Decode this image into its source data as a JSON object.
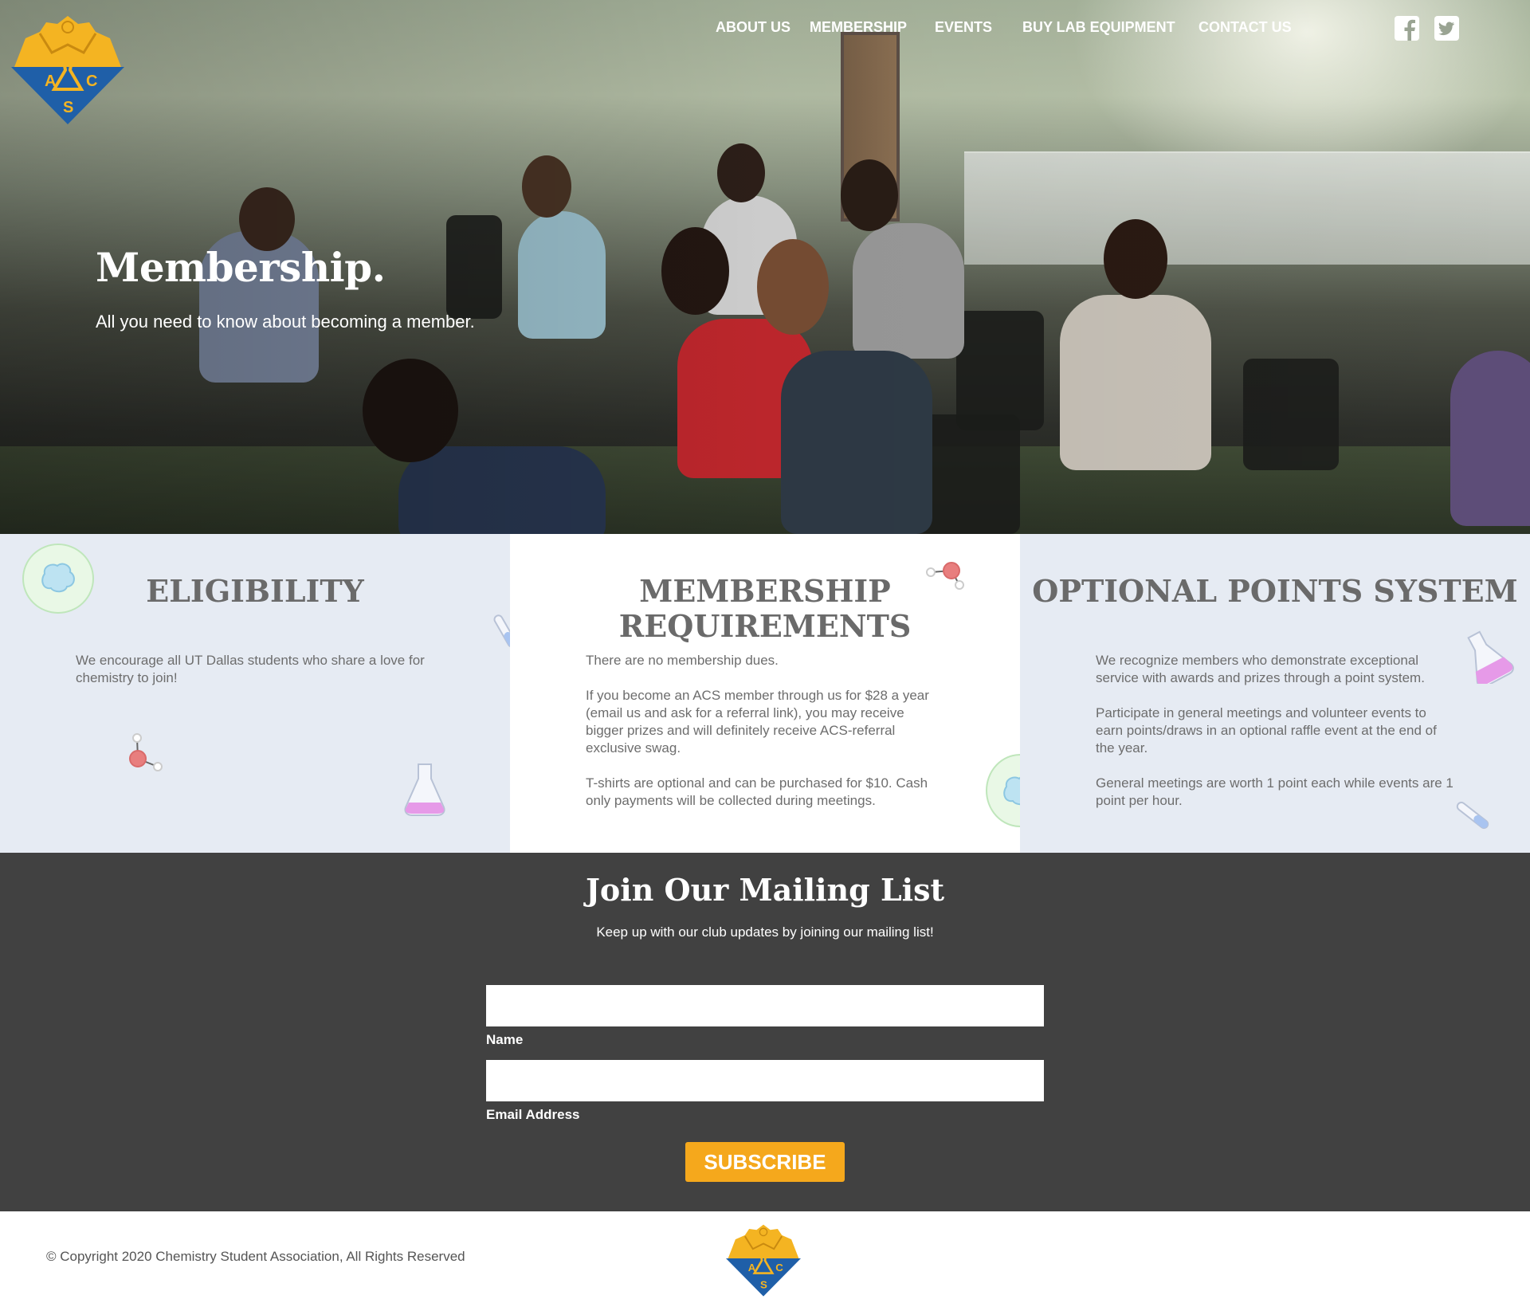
{
  "nav": {
    "items": [
      {
        "label": "ABOUT US"
      },
      {
        "label": "MEMBERSHIP"
      },
      {
        "label": "EVENTS"
      },
      {
        "label": "BUY LAB EQUIPMENT"
      },
      {
        "label": "CONTACT US"
      }
    ],
    "social": [
      {
        "icon": "facebook-icon"
      },
      {
        "icon": "twitter-icon"
      }
    ]
  },
  "logo": {
    "letters": [
      "A",
      "C",
      "S"
    ]
  },
  "hero": {
    "title": "Membership.",
    "subtitle": "All you need to know about becoming a member."
  },
  "columns": {
    "eligibility": {
      "title": "ELIGIBILITY",
      "paragraphs": [
        "We encourage all UT Dallas students who share a love for chemistry to join!"
      ]
    },
    "requirements": {
      "title_line1": "MEMBERSHIP",
      "title_line2": "REQUIREMENTS",
      "paragraphs": [
        "There are no membership dues.",
        "If you become an ACS member through us for $28 a year (email us and ask for a referral link), you may receive bigger prizes and will definitely receive ACS-referral exclusive swag.",
        "T-shirts are optional and can be purchased for $10. Cash only payments will be collected during meetings."
      ]
    },
    "points": {
      "title": "OPTIONAL POINTS SYSTEM",
      "paragraphs": [
        "We recognize members who demonstrate exceptional service with awards and prizes through a point system.",
        "Participate in general meetings and volunteer events to earn points/draws in an optional raffle event at the end of the year.",
        "General meetings are worth 1 point each while events are 1 point per hour."
      ]
    }
  },
  "mailing": {
    "title": "Join Our Mailing List",
    "lead": "Keep up with our club updates by joining our mailing list!",
    "name_label": "Name",
    "name_value": "",
    "email_label": "Email Address",
    "email_value": "",
    "subscribe_label": "SUBSCRIBE"
  },
  "footer": {
    "copyright": "© Copyright 2020 Chemistry Student Association, All Rights Reserved"
  },
  "colors": {
    "accent_gold": "#f5a81c",
    "logo_blue": "#1f5fa8",
    "panel_blue": "#e6ebf3",
    "dark_band": "#414141",
    "heading_gray": "#6a6a6a"
  }
}
